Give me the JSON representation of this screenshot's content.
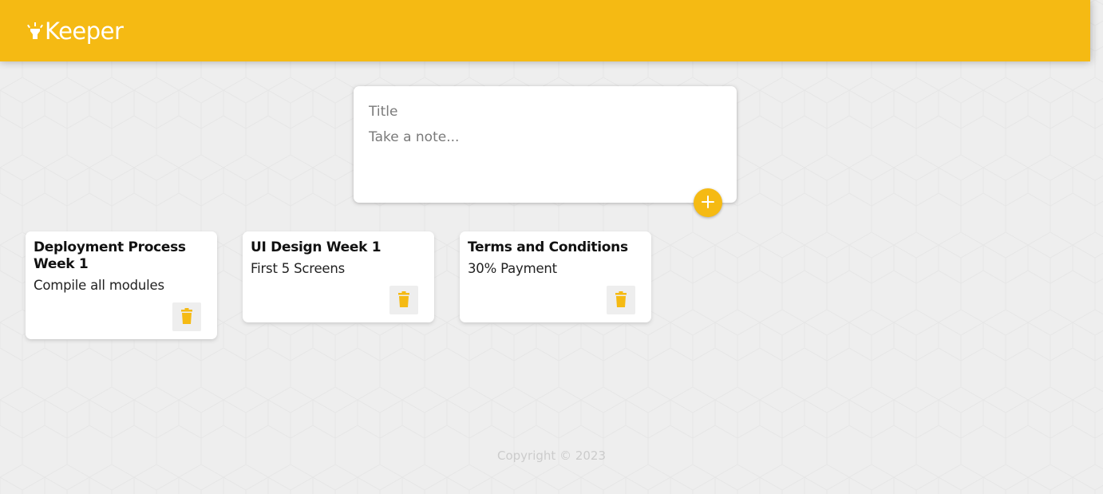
{
  "app": {
    "title": "Keeper",
    "brand_color": "#f5ba13",
    "logo_icon": "highlight-icon"
  },
  "create_note": {
    "title_placeholder": "Title",
    "content_placeholder": "Take a note...",
    "add_icon": "plus-icon"
  },
  "notes": [
    {
      "title": "Deployment Process Week 1",
      "content": "Compile all modules",
      "delete_icon": "trash-icon"
    },
    {
      "title": "UI Design Week 1",
      "content": "First 5 Screens",
      "delete_icon": "trash-icon"
    },
    {
      "title": "Terms and Conditions",
      "content": "30% Payment",
      "delete_icon": "trash-icon"
    }
  ],
  "footer": {
    "copyright": "Copyright © 2023"
  }
}
